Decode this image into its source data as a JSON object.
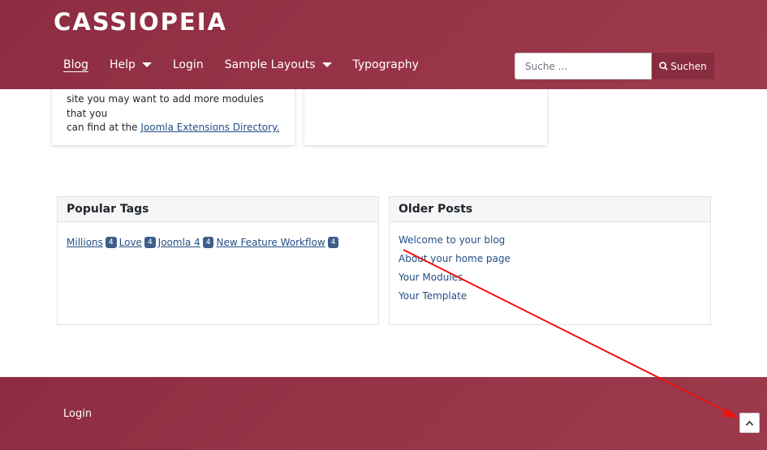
{
  "header": {
    "brand": "CASSIOPEIA",
    "nav": [
      {
        "label": "Blog",
        "active": true,
        "dropdown": false
      },
      {
        "label": "Help",
        "active": false,
        "dropdown": true
      },
      {
        "label": "Login",
        "active": false,
        "dropdown": false
      },
      {
        "label": "Sample Layouts",
        "active": false,
        "dropdown": true
      },
      {
        "label": "Typography",
        "active": false,
        "dropdown": false
      }
    ],
    "search": {
      "placeholder": "Suche ...",
      "button_label": "Suchen"
    }
  },
  "cards": {
    "left_text_line1": "site you may want to add more modules that you",
    "left_text_line2_prefix": "can find at the ",
    "left_text_link": "Joomla Extensions Directory."
  },
  "popular_tags": {
    "title": "Popular Tags",
    "tags": [
      {
        "label": "Millions",
        "count": "4"
      },
      {
        "label": "Love",
        "count": "4"
      },
      {
        "label": "Joomla 4",
        "count": "4"
      },
      {
        "label": "New Feature Workflow",
        "count": "4"
      }
    ]
  },
  "older_posts": {
    "title": "Older Posts",
    "items": [
      "Welcome to your blog",
      "About your home page",
      "Your Modules",
      "Your Template"
    ]
  },
  "footer": {
    "login_label": "Login"
  },
  "colors": {
    "brand": "#993548",
    "link": "#224f85",
    "badge": "#3e5f8a",
    "annotation": "#ee1111"
  },
  "icons": {
    "search": "search-icon",
    "back_to_top": "chevron-up-icon"
  }
}
